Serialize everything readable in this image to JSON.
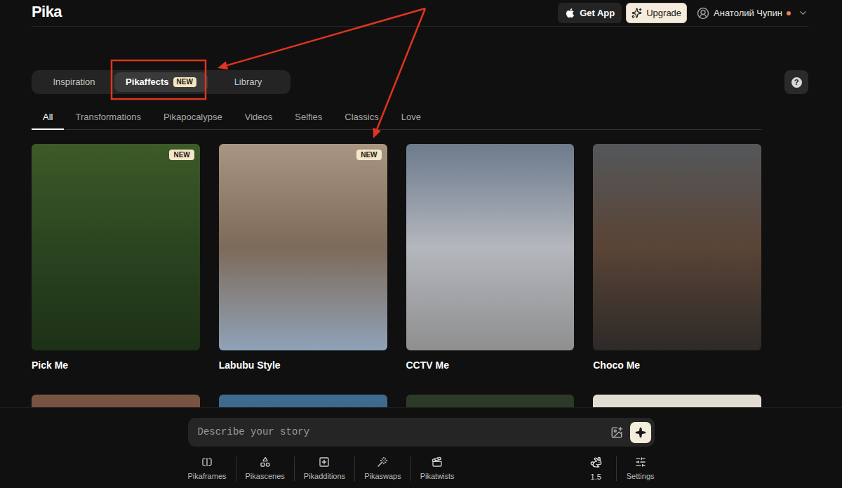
{
  "header": {
    "logo": "Pika",
    "buttons": [
      {
        "label": "Get App",
        "kind": "secondary"
      },
      {
        "label": "Upgrade",
        "kind": "primary"
      }
    ],
    "user": {
      "name": "Анатолий Чупин",
      "status_color": "#e8825a"
    }
  },
  "tabs": [
    {
      "label": "Inspiration",
      "selected": false
    },
    {
      "label": "Pikaffects",
      "selected": true,
      "badge": "NEW"
    },
    {
      "label": "Library",
      "selected": false
    }
  ],
  "help": {
    "label": "?"
  },
  "categories": [
    {
      "label": "All",
      "selected": true
    },
    {
      "label": "Transformations",
      "selected": false
    },
    {
      "label": "Pikapocalypse",
      "selected": false
    },
    {
      "label": "Videos",
      "selected": false
    },
    {
      "label": "Selfies",
      "selected": false
    },
    {
      "label": "Classics",
      "selected": false
    },
    {
      "label": "Love",
      "selected": false
    }
  ],
  "cards": [
    {
      "title": "Pick Me",
      "badge": "NEW",
      "cut_off": false
    },
    {
      "title": "Labubu Style",
      "badge": "NEW",
      "cut_off": false
    },
    {
      "title": "CCTV Me",
      "cut_off": false
    },
    {
      "title": "Choco Me",
      "cut_off": false
    },
    {
      "cut_off": true
    },
    {
      "cut_off": true
    },
    {
      "cut_off": true
    },
    {
      "cut_off": true
    }
  ],
  "prompt": {
    "placeholder": "Describe your story"
  },
  "tools": [
    {
      "label": "Pikaframes"
    },
    {
      "label": "Pikascenes"
    },
    {
      "label": "Pikadditions"
    },
    {
      "label": "Pikaswaps"
    },
    {
      "label": "Pikatwists"
    }
  ],
  "model": {
    "label": "1.5"
  },
  "settings": {
    "label": "Settings"
  }
}
